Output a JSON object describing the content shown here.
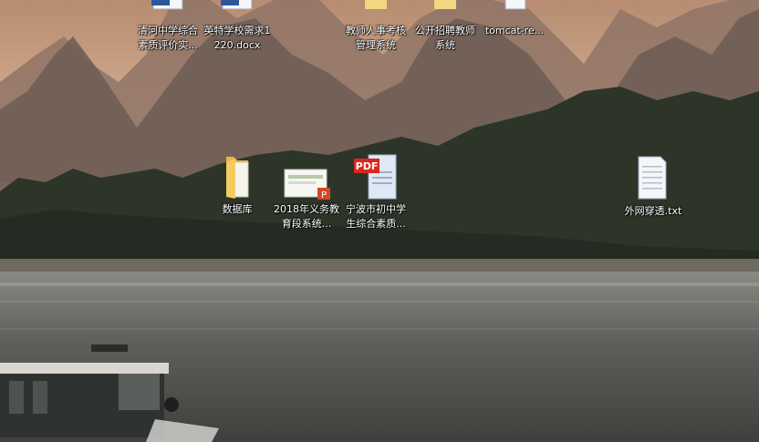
{
  "desktop": {
    "icons": [
      {
        "label": "清河中学综合素质评价实...",
        "icon": "word-doc-icon"
      },
      {
        "label": "英特学校需求1220.docx",
        "icon": "word-doc-icon"
      },
      {
        "label": "教师人事考核管理系统",
        "icon": "shortcut-icon"
      },
      {
        "label": "公开招聘教师系统",
        "icon": "shortcut-icon"
      },
      {
        "label": "tomcat-re...",
        "icon": "file-icon"
      },
      {
        "label": "数据库",
        "icon": "folder-icon"
      },
      {
        "label": "2018年义务教育段系统...",
        "icon": "powerpoint-icon"
      },
      {
        "label": "宁波市初中学生综合素质...",
        "icon": "pdf-icon"
      },
      {
        "label": "外网穿透.txt",
        "icon": "text-file-icon"
      }
    ],
    "badges": {
      "pdf": "PDF",
      "ppt": "P"
    }
  },
  "colors": {
    "sky_top": "#b48a6e",
    "sky_bottom": "#d7b49a",
    "river": "#6b6d6a",
    "trees": "#2f3a2b"
  }
}
